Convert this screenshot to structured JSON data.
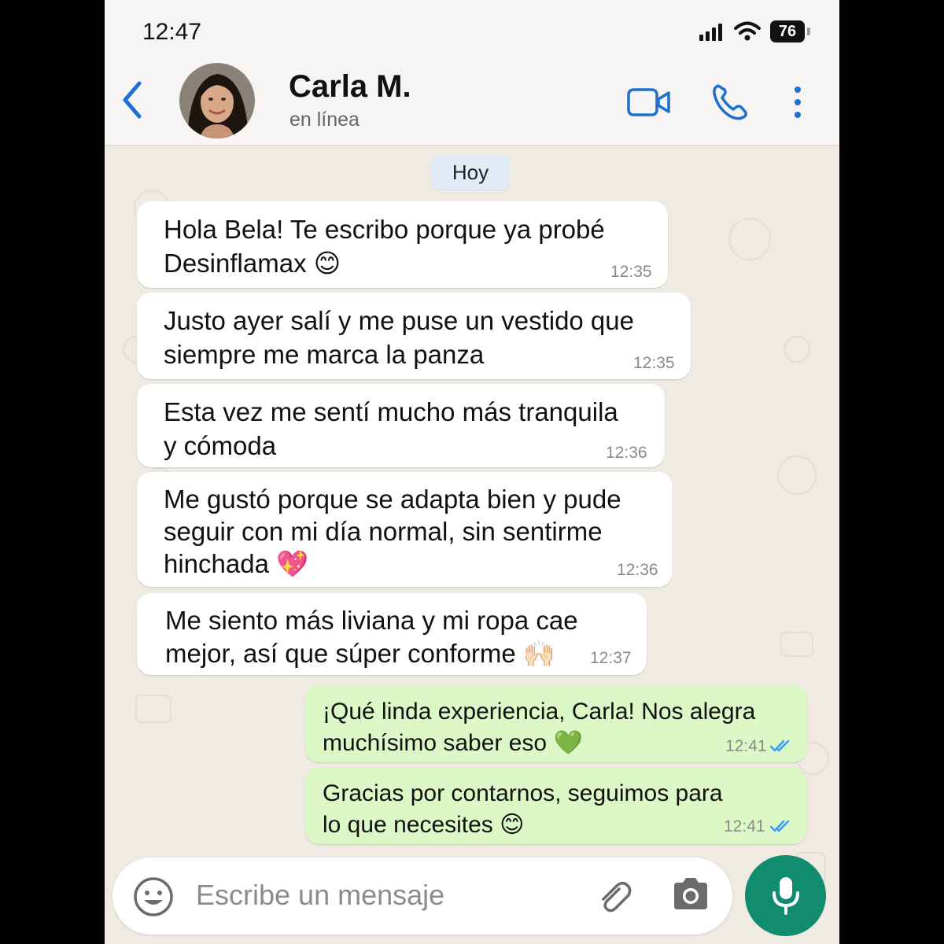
{
  "status_bar": {
    "time": "12:47",
    "battery": "76"
  },
  "header": {
    "contact_name": "Carla M.",
    "presence": "en línea"
  },
  "date_separator": "Hoy",
  "messages": [
    {
      "direction": "in",
      "lines": [
        "Hola Bela! Te escribo porque ya probé",
        "Desinflamax 😊"
      ],
      "time": "12:35"
    },
    {
      "direction": "in",
      "lines": [
        "Justo ayer salí y me puse un vestido que",
        "siempre me marca la panza"
      ],
      "time": "12:35"
    },
    {
      "direction": "in",
      "lines": [
        "Esta vez me sentí mucho más tranquila",
        "y cómoda"
      ],
      "time": "12:36"
    },
    {
      "direction": "in",
      "lines": [
        "Me gustó porque se adapta bien y pude",
        "seguir con mi día normal, sin sentirme",
        "hinchada 💖"
      ],
      "time": "12:36"
    },
    {
      "direction": "in",
      "lines": [
        "Me siento más liviana y mi ropa cae",
        "mejor, así que súper conforme 🙌🏻"
      ],
      "time": "12:37"
    },
    {
      "direction": "out",
      "lines": [
        "¡Qué linda experiencia, Carla! Nos alegra",
        "muchísimo saber eso 💚"
      ],
      "time": "12:41",
      "status": "read"
    },
    {
      "direction": "out",
      "lines": [
        "Gracias por contarnos, seguimos para",
        "lo que necesites 😊"
      ],
      "time": "12:41",
      "status": "read"
    }
  ],
  "composer": {
    "placeholder": "Escribe un mensaje"
  },
  "colors": {
    "accent": "#1f6fd1",
    "incoming": "#ffffff",
    "outgoing": "#dcf8c6",
    "mic": "#128c6e",
    "read_ticks": "#3b9cf0"
  },
  "icons": {
    "back": "chevron-left-icon",
    "video": "video-call-icon",
    "call": "phone-icon",
    "menu": "more-vertical-icon",
    "emoji": "emoji-icon",
    "attach": "paperclip-icon",
    "camera": "camera-icon",
    "mic": "microphone-icon"
  }
}
